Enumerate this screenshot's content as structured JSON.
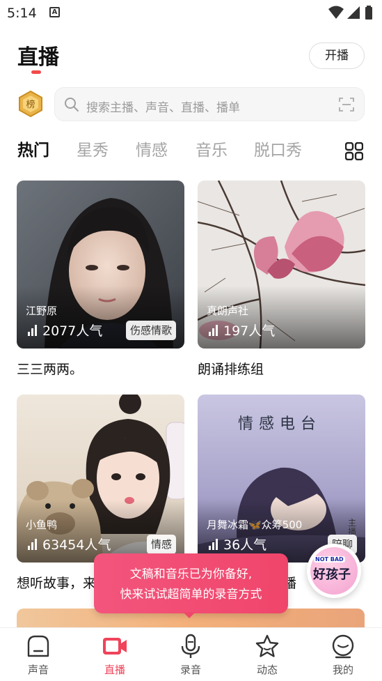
{
  "status_bar": {
    "time": "5:14",
    "sim_icon": "A"
  },
  "header": {
    "title": "直播",
    "start_button": "开播"
  },
  "search": {
    "placeholder": "搜索主播、声音、直播、播单",
    "rank_badge": "榜"
  },
  "tabs": [
    "热门",
    "星秀",
    "情感",
    "音乐",
    "脱口秀"
  ],
  "cards": [
    {
      "host": "江野原",
      "popularity": "2077人气",
      "tag": "伤感情歌",
      "title": "三三两两。"
    },
    {
      "host": "真朗声社",
      "popularity": "197人气",
      "tag": "",
      "title": "朗诵排练组"
    },
    {
      "host": "小鱼鸭",
      "popularity": "63454人气",
      "tag": "情感",
      "title": "想听故事，来"
    },
    {
      "host": "月舞冰霜🦋众筹500",
      "popularity": "36人气",
      "tag": "陪聊",
      "title": "播",
      "overlay": "情感电台",
      "side_text": "主播"
    }
  ],
  "tooltip": {
    "line1": "文稿和音乐已为你备好,",
    "line2": "快来试试超简单的录音方式"
  },
  "float_badge": {
    "small": "NOT BAD",
    "brand": "好孩子"
  },
  "bottom_nav": [
    {
      "label": "声音",
      "icon": "sound-icon"
    },
    {
      "label": "直播",
      "icon": "live-camera-icon"
    },
    {
      "label": "录音",
      "icon": "microphone-icon"
    },
    {
      "label": "动态",
      "icon": "star-icon"
    },
    {
      "label": "我的",
      "icon": "profile-icon"
    }
  ],
  "colors": {
    "accent": "#f0435a",
    "tooltip": "#f14a70"
  }
}
